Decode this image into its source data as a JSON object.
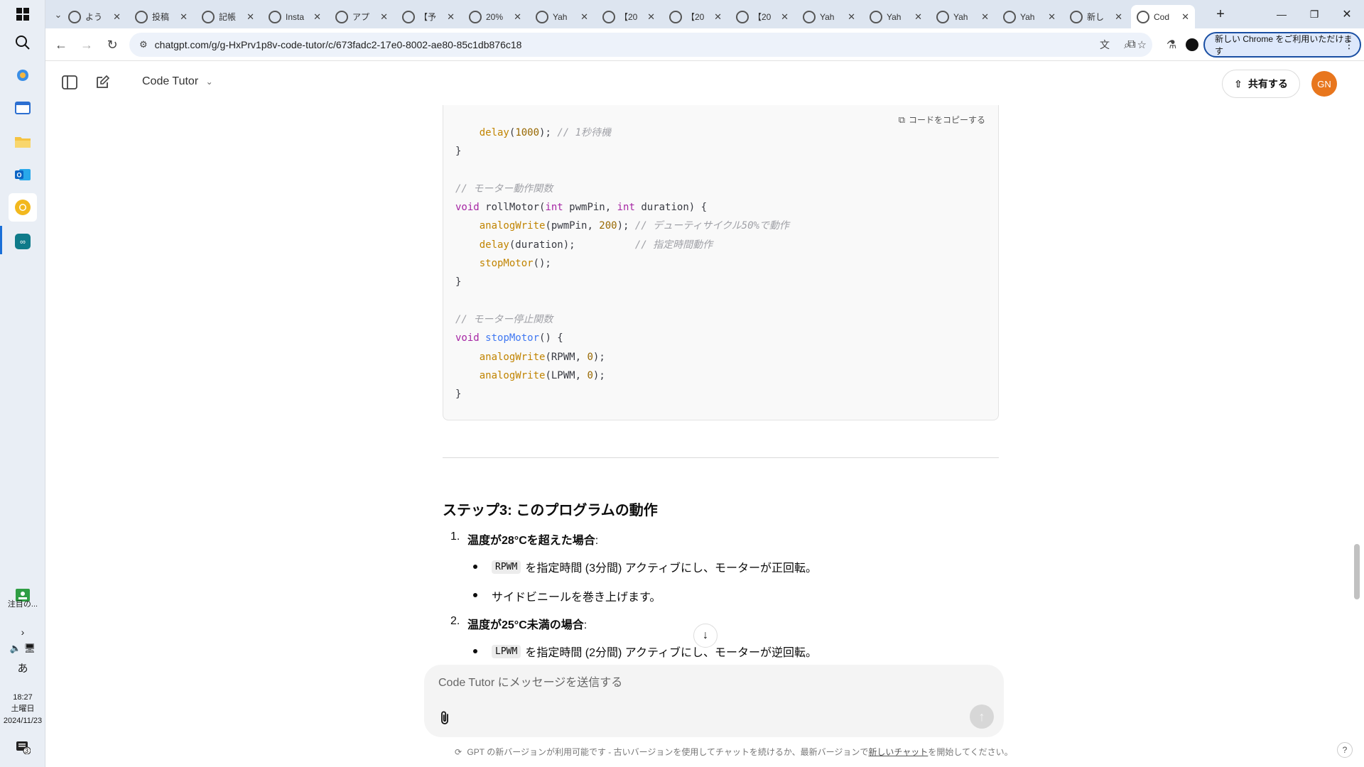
{
  "taskbar": {
    "notify_label": "注目の...",
    "time": "18:27",
    "weekday": "土曜日",
    "date": "2024/11/23",
    "ime": "あ",
    "chat_badge": "3"
  },
  "tabs": [
    {
      "label": "よう"
    },
    {
      "label": "投稿"
    },
    {
      "label": "記帳"
    },
    {
      "label": "Insta"
    },
    {
      "label": "アプ"
    },
    {
      "label": "【予"
    },
    {
      "label": "20%"
    },
    {
      "label": "Yah"
    },
    {
      "label": "【20"
    },
    {
      "label": "【20"
    },
    {
      "label": "【20"
    },
    {
      "label": "Yah"
    },
    {
      "label": "Yah"
    },
    {
      "label": "Yah"
    },
    {
      "label": "Yah"
    },
    {
      "label": "新し"
    },
    {
      "label": "Cod"
    }
  ],
  "toolbar": {
    "url": "chatgpt.com/g/g-HxPrv1p8v-code-tutor/c/673fadc2-17e0-8002-ae80-85c1db876c18",
    "chrome_badge": "新しい Chrome をご利用いただけます"
  },
  "header": {
    "gpt_name": "Code Tutor",
    "share_label": "共有する",
    "avatar_initials": "GN"
  },
  "code": {
    "copy_label": "コードをコピーする",
    "lines": [
      "    delay(1000); // 1秒待機",
      "}",
      "",
      "// モーター動作関数",
      "void rollMotor(int pwmPin, int duration) {",
      "    analogWrite(pwmPin, 200); // デューティサイクル50%で動作",
      "    delay(duration);          // 指定時間動作",
      "    stopMotor();",
      "}",
      "",
      "// モーター停止関数",
      "void stopMotor() {",
      "    analogWrite(RPWM, 0);",
      "    analogWrite(LPWM, 0);",
      "}"
    ]
  },
  "answer": {
    "step_title": "ステップ3: このプログラムの動作",
    "items": [
      {
        "num": "1.",
        "title": "温度が28°Cを超えた場合",
        "colon": ":",
        "bullets": [
          {
            "code": "RPWM",
            "text": "を指定時間 (3分間) アクティブにし、モーターが正回転。"
          },
          {
            "code": "",
            "text": "サイドビニールを巻き上げます。"
          }
        ]
      },
      {
        "num": "2.",
        "title": "温度が25°C未満の場合",
        "colon": ":",
        "bullets": [
          {
            "code": "LPWM",
            "text": "を指定時間 (2分間) アクティブにし、モーターが逆回転。"
          }
        ]
      }
    ]
  },
  "composer": {
    "placeholder": "Code Tutor にメッセージを送信する"
  },
  "notice": {
    "prefix": "GPT の新バージョンが利用可能です - 古いバージョンを使用してチャットを続けるか、最新バージョンで",
    "link": "新しいチャット",
    "suffix": "を開始してください。"
  },
  "help_label": "?"
}
